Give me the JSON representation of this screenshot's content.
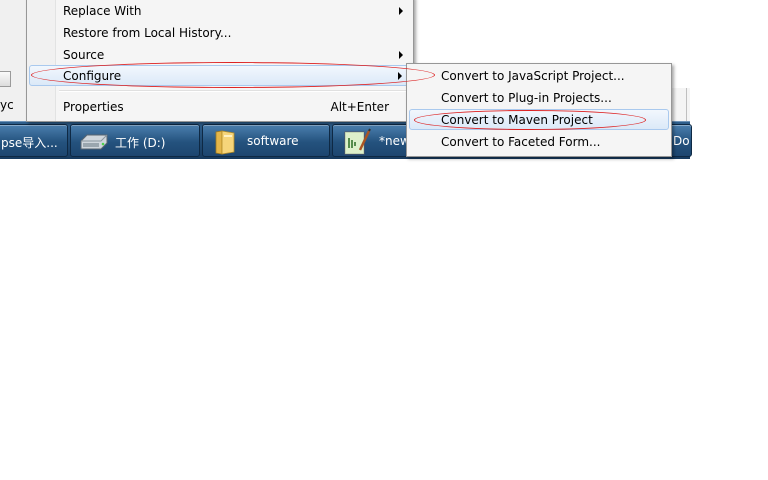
{
  "background": {
    "left_clip_text": "yc"
  },
  "context_menu": {
    "items": [
      {
        "label": "Replace With",
        "has_submenu": true
      },
      {
        "label": "Restore from Local History...",
        "has_submenu": false
      },
      {
        "label": "Source",
        "has_submenu": true
      },
      {
        "label": "Configure",
        "has_submenu": true,
        "highlighted": true
      },
      {
        "label": "Properties",
        "shortcut": "Alt+Enter",
        "has_submenu": false
      }
    ]
  },
  "submenu": {
    "items": [
      {
        "label": "Convert to JavaScript Project..."
      },
      {
        "label": "Convert to Plug-in Projects..."
      },
      {
        "label": "Convert to Maven Project",
        "highlighted": true
      },
      {
        "label": "Convert to Faceted Form..."
      }
    ]
  },
  "taskbar": {
    "buttons": [
      {
        "label": "pse导入...",
        "icon": "none"
      },
      {
        "label": "工作 (D:)",
        "icon": "drive-icon"
      },
      {
        "label": "software",
        "icon": "folder-icon"
      },
      {
        "label": "*new",
        "icon": "notepad-plus-plus-icon"
      },
      {
        "label": "Do",
        "icon": "none"
      }
    ]
  },
  "colors": {
    "annotation_red": "#d22222",
    "highlight_border": "#a9c9ee",
    "taskbar_blue": "#24527e"
  }
}
